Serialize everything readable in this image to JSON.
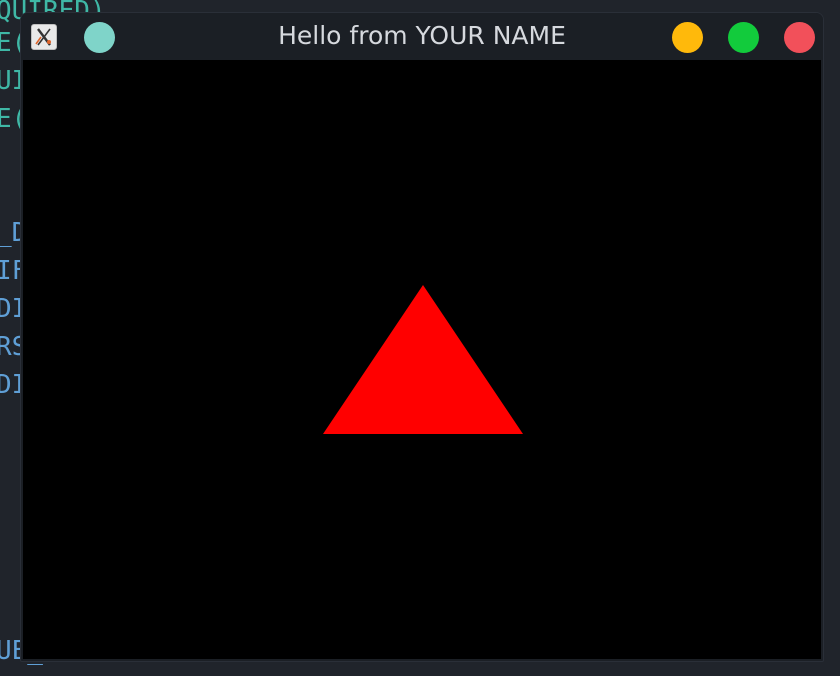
{
  "background_editor": {
    "lines": [
      {
        "text": "QUIRED)",
        "color": "teal"
      },
      {
        "text": "E(",
        "color": "teal"
      },
      {
        "text": "UI",
        "color": "teal"
      },
      {
        "text": "E(",
        "color": "teal"
      },
      {
        "text": "_D",
        "color": "blue"
      },
      {
        "text": "IF",
        "color": "blue"
      },
      {
        "text": "DI",
        "color": "blue"
      },
      {
        "text": "RS",
        "color": "blue"
      },
      {
        "text": "DI",
        "color": "blue"
      },
      {
        "text": "UE_",
        "color": "blue"
      }
    ]
  },
  "window": {
    "title": "Hello from YOUR NAME",
    "app_icon": "x-app-icon",
    "controls": {
      "pin": {
        "icon": "pin-circle-icon",
        "color": "#7fd4c9"
      },
      "minimize": {
        "icon": "minimize-circle-icon",
        "color": "#ffb90b"
      },
      "maximize": {
        "icon": "maximize-circle-icon",
        "color": "#12cb3c"
      },
      "close": {
        "icon": "close-circle-icon",
        "color": "#f2505a"
      }
    }
  },
  "canvas": {
    "background_color": "#000000",
    "shape": "triangle",
    "shape_color": "#ff0000"
  }
}
